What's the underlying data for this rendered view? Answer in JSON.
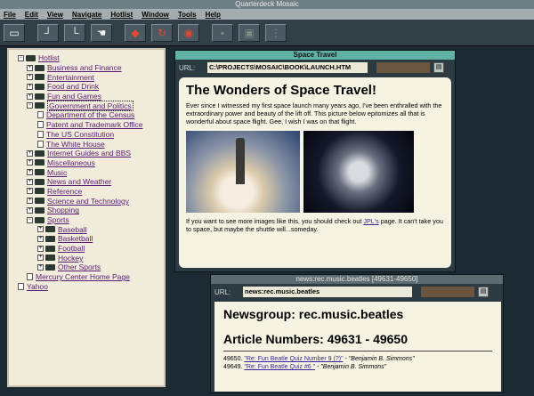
{
  "app": {
    "title": "Quarterdeck Mosaic"
  },
  "menu": [
    "File",
    "Edit",
    "View",
    "Navigate",
    "Hotlist",
    "Window",
    "Tools",
    "Help"
  ],
  "toolbar": {
    "buttons": [
      {
        "name": "open-icon",
        "glyph": "▭"
      },
      {
        "name": "back-icon",
        "glyph": "┘"
      },
      {
        "name": "home-icon",
        "glyph": "└"
      },
      {
        "name": "hand-icon",
        "glyph": "☚"
      },
      {
        "name": "stop-icon",
        "glyph": "◆"
      },
      {
        "name": "reload-icon",
        "glyph": "↻"
      },
      {
        "name": "mosaic-logo-icon",
        "glyph": "◉"
      },
      {
        "name": "print-icon",
        "glyph": "▪"
      },
      {
        "name": "save-icon",
        "glyph": "▣"
      },
      {
        "name": "help-icon",
        "glyph": "⋮"
      }
    ]
  },
  "hotlist": {
    "items": [
      {
        "label": "Hotlist",
        "level": 0,
        "type": "folder",
        "exp": "−"
      },
      {
        "label": "Business and Finance",
        "level": 1,
        "type": "folder",
        "exp": "+"
      },
      {
        "label": "Entertainment",
        "level": 1,
        "type": "folder",
        "exp": "+"
      },
      {
        "label": "Food and Drink",
        "level": 1,
        "type": "folder",
        "exp": "+"
      },
      {
        "label": "Fun and Games",
        "level": 1,
        "type": "folder",
        "exp": "+"
      },
      {
        "label": "Government and Politics",
        "level": 1,
        "type": "folder",
        "exp": "−",
        "selected": true
      },
      {
        "label": "Department of the Census",
        "level": 2,
        "type": "doc"
      },
      {
        "label": "Patent and Trademark Office",
        "level": 2,
        "type": "doc"
      },
      {
        "label": "The US Constitution",
        "level": 2,
        "type": "doc"
      },
      {
        "label": "The White House",
        "level": 2,
        "type": "doc"
      },
      {
        "label": "Internet Guides and BBS",
        "level": 1,
        "type": "folder",
        "exp": "+"
      },
      {
        "label": "Miscellaneous",
        "level": 1,
        "type": "folder",
        "exp": "+"
      },
      {
        "label": "Music",
        "level": 1,
        "type": "folder",
        "exp": "+"
      },
      {
        "label": "News and Weather",
        "level": 1,
        "type": "folder",
        "exp": "+"
      },
      {
        "label": "Reference",
        "level": 1,
        "type": "folder",
        "exp": "+"
      },
      {
        "label": "Science and Technology",
        "level": 1,
        "type": "folder",
        "exp": "+"
      },
      {
        "label": "Shopping",
        "level": 1,
        "type": "folder",
        "exp": "+"
      },
      {
        "label": "Sports",
        "level": 1,
        "type": "folder",
        "exp": "−"
      },
      {
        "label": "Baseball",
        "level": 2,
        "type": "folder",
        "exp": "+"
      },
      {
        "label": "Basketball",
        "level": 2,
        "type": "folder",
        "exp": "+"
      },
      {
        "label": "Football",
        "level": 2,
        "type": "folder",
        "exp": "+"
      },
      {
        "label": "Hockey",
        "level": 2,
        "type": "folder",
        "exp": "+"
      },
      {
        "label": "Other Sports",
        "level": 2,
        "type": "folder",
        "exp": "+"
      },
      {
        "label": "Mercury Center Home Page",
        "level": 1,
        "type": "doc"
      },
      {
        "label": "Yahoo",
        "level": 0,
        "type": "doc"
      }
    ]
  },
  "window1": {
    "title": "Space Travel",
    "url_label": "URL:",
    "url": "C:\\PROJECTS\\MOSAIC\\BOOK\\LAUNCH.HTM",
    "heading": "The Wonders of Space Travel!",
    "intro": "Ever since I witnessed my first space launch many years ago, I've been enthralled with the extraordinary power and beauty of the lift off. This picture below epitomizes all that is wonderful about space flight. Gee, I wish I was on that flight.",
    "outro_pre": "If you want to see more images like this, you should check out ",
    "outro_link": "JPL's",
    "outro_post": " page. It can't take you to space, but maybe the shuttle will...someday."
  },
  "window2": {
    "title": "news:rec.music.beatles [49631-49650]",
    "url_label": "URL:",
    "url": "news:rec.music.beatles",
    "heading": "Newsgroup: rec.music.beatles",
    "subheading": "Article Numbers: 49631 - 49650",
    "articles": [
      {
        "num": "49650.",
        "title": "\"Re: Fun Beatle Quiz Number 9 (?)\"",
        "author": "\"Benjamin B. Simmons\""
      },
      {
        "num": "49649.",
        "title": "\"Re: Fun Beatle Quiz #6 \"",
        "author": "\"Benjamin B. Simmons\""
      }
    ]
  }
}
